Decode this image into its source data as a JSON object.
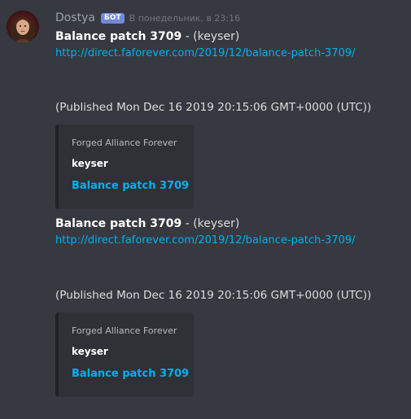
{
  "author": {
    "name": "Dostya",
    "bot_tag": "БОТ",
    "timestamp": "В понедельник, в 23:16"
  },
  "messages": [
    {
      "title": "Balance patch 3709",
      "author_suffix": " - (keyser)",
      "url": "http://direct.faforever.com/2019/12/balance-patch-3709/",
      "published": "(Published Mon Dec 16 2019 20:15:06 GMT+0000 (UTC))",
      "embed": {
        "provider": "Forged Alliance Forever",
        "author": "keyser",
        "title": "Balance patch 3709"
      }
    },
    {
      "title": "Balance patch 3709",
      "author_suffix": " - (keyser)",
      "url": "http://direct.faforever.com/2019/12/balance-patch-3709/",
      "published": "(Published Mon Dec 16 2019 20:15:06 GMT+0000 (UTC))",
      "embed": {
        "provider": "Forged Alliance Forever",
        "author": "keyser",
        "title": "Balance patch 3709"
      }
    }
  ]
}
